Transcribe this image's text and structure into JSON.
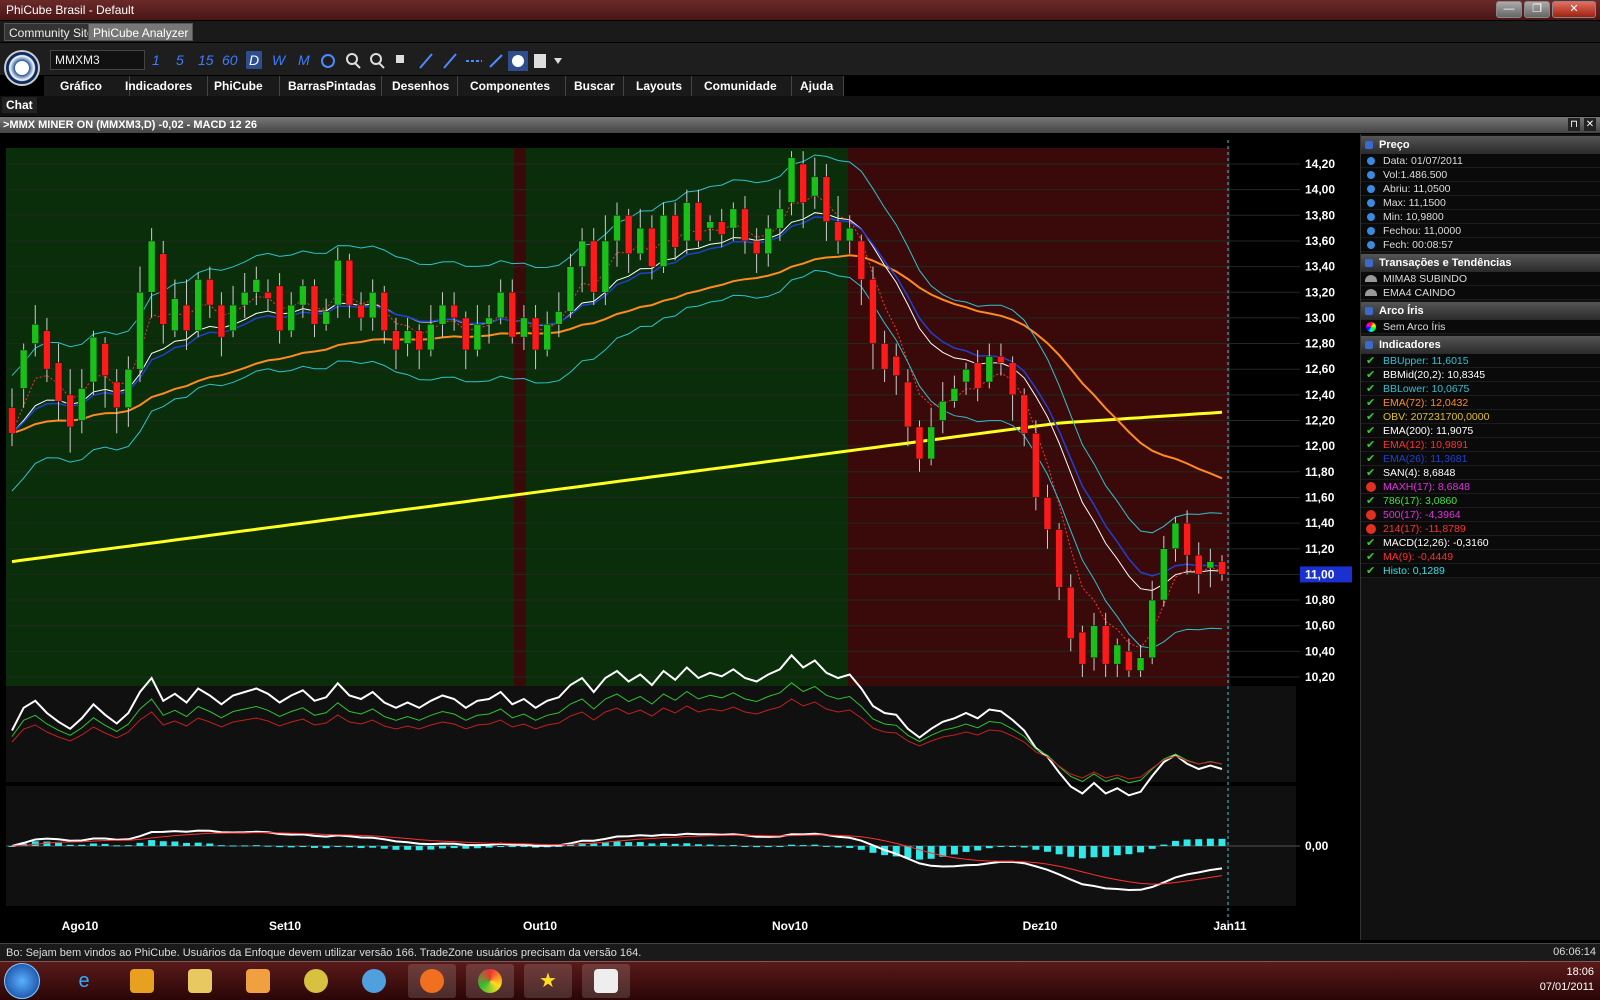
{
  "window": {
    "title": "PhiCube Brasil - Default",
    "controls": [
      "—",
      "❐",
      "✕"
    ]
  },
  "tabs": [
    {
      "label": "Community Site",
      "active": false
    },
    {
      "label": "PhiCube Analyzer",
      "active": true
    }
  ],
  "toolbar": {
    "symbol": "MMXM3",
    "periods": [
      "1",
      "5",
      "15",
      "60",
      "D",
      "W",
      "M"
    ],
    "selected_period": "D"
  },
  "menu": [
    "Gráfico",
    "Indicadores",
    "PhiCube",
    "BarrasPintadas",
    "Desenhos",
    "Componentes",
    "Buscar",
    "Layouts",
    "Comunidade",
    "Ajuda"
  ],
  "chat_label": "Chat",
  "chart_header": ">MMX MINER  ON  (MMXM3,D)  -0,02 - MACD 12 26",
  "chart_data": {
    "type": "candlestick",
    "price_axis": [
      "14,20",
      "14,00",
      "13,80",
      "13,60",
      "13,40",
      "13,20",
      "13,00",
      "12,80",
      "12,60",
      "12,40",
      "12,20",
      "12,00",
      "11,80",
      "11,60",
      "11,40",
      "11,20",
      "11,00",
      "10,80",
      "10,60",
      "10,40",
      "10,20"
    ],
    "current_price_label": "11,00",
    "ylim": [
      10.2,
      14.2
    ],
    "macd_axis_label": "0,00",
    "time_axis": [
      "Ago10",
      "Set10",
      "Out10",
      "Nov10",
      "Dez10",
      "Jan11"
    ],
    "candles": [
      [
        12.3,
        12.1,
        12.45,
        12.0
      ],
      [
        12.45,
        12.75,
        12.8,
        12.3
      ],
      [
        12.8,
        12.95,
        13.1,
        12.7
      ],
      [
        12.9,
        12.6,
        13.0,
        12.5
      ],
      [
        12.65,
        12.35,
        12.8,
        12.2
      ],
      [
        12.4,
        12.15,
        12.6,
        11.95
      ],
      [
        12.2,
        12.45,
        12.6,
        12.1
      ],
      [
        12.5,
        12.85,
        12.9,
        12.4
      ],
      [
        12.8,
        12.55,
        12.85,
        12.3
      ],
      [
        12.5,
        12.3,
        12.6,
        12.1
      ],
      [
        12.3,
        12.6,
        12.7,
        12.15
      ],
      [
        12.6,
        13.2,
        13.4,
        12.5
      ],
      [
        13.2,
        13.6,
        13.7,
        13.0
      ],
      [
        13.5,
        12.95,
        13.6,
        12.8
      ],
      [
        12.9,
        13.15,
        13.3,
        12.85
      ],
      [
        13.1,
        12.9,
        13.3,
        12.75
      ],
      [
        12.9,
        13.3,
        13.35,
        12.85
      ],
      [
        13.3,
        13.1,
        13.4,
        13.0
      ],
      [
        13.1,
        12.85,
        13.2,
        12.7
      ],
      [
        12.9,
        13.1,
        13.25,
        12.85
      ],
      [
        13.1,
        13.2,
        13.35,
        13.0
      ],
      [
        13.2,
        13.3,
        13.4,
        13.1
      ],
      [
        13.2,
        13.15,
        13.3,
        13.05
      ],
      [
        13.25,
        12.9,
        13.35,
        12.8
      ],
      [
        12.9,
        13.1,
        13.2,
        12.85
      ],
      [
        13.1,
        13.25,
        13.3,
        13.0
      ],
      [
        13.25,
        12.95,
        13.3,
        12.85
      ],
      [
        12.95,
        13.05,
        13.15,
        12.9
      ],
      [
        13.1,
        13.45,
        13.55,
        13.0
      ],
      [
        13.45,
        13.1,
        13.5,
        13.0
      ],
      [
        13.1,
        13.0,
        13.2,
        12.9
      ],
      [
        13.0,
        13.2,
        13.3,
        12.9
      ],
      [
        13.2,
        12.9,
        13.25,
        12.8
      ],
      [
        12.9,
        12.75,
        13.0,
        12.6
      ],
      [
        12.8,
        12.9,
        13.0,
        12.7
      ],
      [
        12.9,
        12.75,
        12.95,
        12.6
      ],
      [
        12.75,
        12.95,
        13.1,
        12.7
      ],
      [
        12.95,
        13.1,
        13.2,
        12.85
      ],
      [
        13.1,
        13.0,
        13.2,
        12.9
      ],
      [
        13.0,
        12.75,
        13.05,
        12.6
      ],
      [
        12.75,
        12.95,
        13.1,
        12.7
      ],
      [
        12.95,
        13.0,
        13.1,
        12.8
      ],
      [
        13.0,
        13.2,
        13.3,
        12.95
      ],
      [
        13.2,
        12.85,
        13.3,
        12.8
      ],
      [
        12.85,
        13.0,
        13.1,
        12.75
      ],
      [
        13.0,
        12.75,
        13.1,
        12.6
      ],
      [
        12.75,
        12.95,
        13.05,
        12.7
      ],
      [
        12.95,
        13.05,
        13.2,
        12.85
      ],
      [
        13.05,
        13.4,
        13.5,
        13.0
      ],
      [
        13.4,
        13.6,
        13.7,
        13.2
      ],
      [
        13.6,
        13.2,
        13.7,
        13.1
      ],
      [
        13.2,
        13.6,
        13.8,
        13.1
      ],
      [
        13.6,
        13.8,
        13.9,
        13.4
      ],
      [
        13.8,
        13.5,
        13.85,
        13.35
      ],
      [
        13.5,
        13.7,
        13.85,
        13.45
      ],
      [
        13.7,
        13.4,
        13.8,
        13.3
      ],
      [
        13.4,
        13.8,
        13.9,
        13.35
      ],
      [
        13.8,
        13.55,
        13.9,
        13.45
      ],
      [
        13.6,
        13.9,
        14.0,
        13.5
      ],
      [
        13.9,
        13.6,
        14.0,
        13.55
      ],
      [
        13.7,
        13.75,
        13.8,
        13.6
      ],
      [
        13.75,
        13.65,
        13.85,
        13.55
      ],
      [
        13.7,
        13.85,
        13.9,
        13.6
      ],
      [
        13.85,
        13.6,
        13.95,
        13.5
      ],
      [
        13.6,
        13.5,
        13.7,
        13.35
      ],
      [
        13.5,
        13.7,
        13.8,
        13.4
      ],
      [
        13.7,
        13.85,
        14.0,
        13.6
      ],
      [
        13.9,
        14.25,
        14.3,
        13.8
      ],
      [
        14.2,
        13.9,
        14.3,
        13.7
      ],
      [
        13.95,
        14.1,
        14.25,
        13.85
      ],
      [
        14.1,
        13.75,
        14.2,
        13.6
      ],
      [
        13.75,
        13.6,
        13.95,
        13.5
      ],
      [
        13.6,
        13.7,
        13.8,
        13.5
      ],
      [
        13.6,
        13.3,
        13.65,
        13.1
      ],
      [
        13.3,
        12.8,
        13.4,
        12.6
      ],
      [
        12.8,
        12.6,
        12.9,
        12.5
      ],
      [
        12.7,
        12.55,
        12.8,
        12.4
      ],
      [
        12.5,
        12.15,
        12.6,
        12.0
      ],
      [
        12.15,
        11.9,
        12.2,
        11.8
      ],
      [
        11.9,
        12.15,
        12.3,
        11.85
      ],
      [
        12.2,
        12.35,
        12.5,
        12.1
      ],
      [
        12.35,
        12.45,
        12.55,
        12.3
      ],
      [
        12.5,
        12.6,
        12.65,
        12.4
      ],
      [
        12.65,
        12.45,
        12.75,
        12.35
      ],
      [
        12.5,
        12.7,
        12.8,
        12.45
      ],
      [
        12.7,
        12.65,
        12.8,
        12.55
      ],
      [
        12.65,
        12.4,
        12.7,
        12.2
      ],
      [
        12.4,
        12.1,
        12.45,
        12.0
      ],
      [
        12.1,
        11.6,
        12.2,
        11.5
      ],
      [
        11.6,
        11.35,
        11.7,
        11.2
      ],
      [
        11.35,
        10.9,
        11.4,
        10.8
      ],
      [
        10.9,
        10.5,
        11.0,
        10.4
      ],
      [
        10.55,
        10.3,
        10.6,
        10.2
      ],
      [
        10.35,
        10.6,
        10.7,
        10.25
      ],
      [
        10.6,
        10.3,
        10.7,
        10.2
      ],
      [
        10.3,
        10.45,
        10.5,
        10.2
      ],
      [
        10.4,
        10.25,
        10.5,
        10.2
      ],
      [
        10.25,
        10.35,
        10.45,
        10.2
      ],
      [
        10.35,
        10.8,
        10.95,
        10.3
      ],
      [
        10.8,
        11.2,
        11.3,
        10.75
      ],
      [
        11.2,
        11.4,
        11.45,
        11.1
      ],
      [
        11.4,
        11.15,
        11.5,
        11.0
      ],
      [
        11.15,
        11.0,
        11.25,
        10.85
      ],
      [
        11.05,
        11.1,
        11.2,
        10.9
      ],
      [
        11.1,
        11.0,
        11.15,
        10.95
      ]
    ],
    "indicators": [
      {
        "label": "BBUpper: 11,6015",
        "color": "#30c0d0",
        "status": "on"
      },
      {
        "label": "BBMid(20,2): 10,8345",
        "color": "#ffffff",
        "status": "on"
      },
      {
        "label": "BBLower: 10,0675",
        "color": "#30c0d0",
        "status": "on"
      },
      {
        "label": "EMA(72): 12,0432",
        "color": "#ff8a20",
        "status": "on"
      },
      {
        "label": "OBV: 207231700,0000",
        "color": "#e0c020",
        "status": "on"
      },
      {
        "label": "EMA(200): 11,9075",
        "color": "#ffffff",
        "status": "on"
      },
      {
        "label": "EMA(12): 10,9891",
        "color": "#ff3030",
        "status": "on"
      },
      {
        "label": "EMA(26): 11,3681",
        "color": "#2040d0",
        "status": "on"
      },
      {
        "label": "SAN(4): 8,6848",
        "color": "#ffffff",
        "status": "on"
      },
      {
        "label": "MAXH(17): 8,6848",
        "color": "#e030e0",
        "status": "off"
      },
      {
        "label": "786(17): 3,0860",
        "color": "#40e040",
        "status": "on"
      },
      {
        "label": "500(17): -4,3964",
        "color": "#e030e0",
        "status": "off"
      },
      {
        "label": "214(17): -11,8789",
        "color": "#ff3030",
        "status": "off"
      },
      {
        "label": "MACD(12,26): -0,3160",
        "color": "#ffffff",
        "status": "on"
      },
      {
        "label": "MA(9): -0,4449",
        "color": "#ff3030",
        "status": "on"
      },
      {
        "label": "Histo: 0,1289",
        "color": "#30e0e0",
        "status": "on"
      }
    ]
  },
  "panel": {
    "price_title": "Preço",
    "price_rows": [
      "Data: 01/07/2011",
      "Vol:1.486.500",
      "Abriu: 11,0500",
      "Max: 11,1500",
      "Min: 10,9800",
      "Fechou: 11,0000",
      "Fech: 00:08:57"
    ],
    "trends_title": "Transações e Tendências",
    "trends_rows": [
      "MIMA8 SUBINDO",
      "EMA4 CAINDO"
    ],
    "arc_title": "Arco Íris",
    "arc_rows": [
      "Sem Arco Íris"
    ],
    "ind_title": "Indicadores"
  },
  "status": {
    "message": "Bo: Sejam bem vindos ao PhiCube.  Usuários da Enfoque devem utilizar versão 166.  TradeZone usuários precisam da versão 164.",
    "time": "06:06:14"
  },
  "taskbar": {
    "time": "18:06",
    "date": "07/01/2011"
  },
  "colors": {
    "bull": "#18c018",
    "bear": "#ff1a1a",
    "green_zone": "#0a2e0a",
    "red_zone": "#3a0a0a",
    "accent": "#2d4d8f"
  }
}
